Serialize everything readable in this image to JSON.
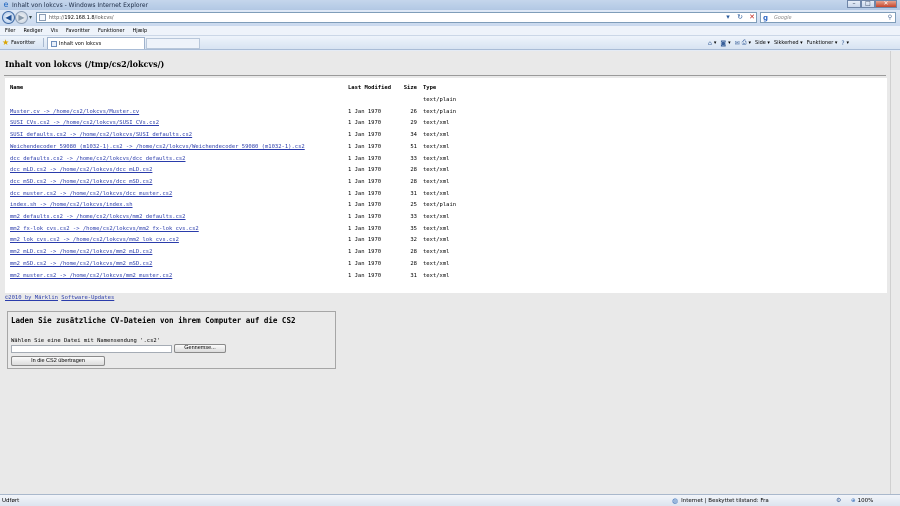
{
  "window": {
    "title": "Inhalt von lokcvs - Windows Internet Explorer",
    "min": "–",
    "max": "□",
    "close": "✕"
  },
  "addressbar": {
    "url_prefix": "http://",
    "url_host": "192.168.1.8",
    "url_path": "/lokcvs/",
    "search_placeholder": "Google"
  },
  "menu": [
    "Filer",
    "Rediger",
    "Vis",
    "Favoritter",
    "Funktioner",
    "Hjælp"
  ],
  "favbar": {
    "favorites_label": "Favoritter",
    "tab_label": "Inhalt von lokcvs",
    "commands": [
      "Side ▾",
      "Sikkerhed ▾",
      "Funktioner ▾"
    ]
  },
  "page": {
    "heading": "Inhalt von lokcvs (/tmp/cs2/lokcvs/)",
    "columns": {
      "name": "Name",
      "date": "Last Modified",
      "size": "Size",
      "type": "Type"
    },
    "rows": [
      {
        "name": "",
        "date": "",
        "size": "",
        "type": "text/plain"
      },
      {
        "name": "Muster.cv -> /home/cs2/lokcvs/Muster.cv",
        "date": "1 Jan 1970",
        "size": "26",
        "type": "text/plain"
      },
      {
        "name": "SUSI_CVs.cs2 -> /home/cs2/lokcvs/SUSI_CVs.cs2",
        "date": "1 Jan 1970",
        "size": "29",
        "type": "text/xml"
      },
      {
        "name": "SUSI_defaults.cs2 -> /home/cs2/lokcvs/SUSI_defaults.cs2",
        "date": "1 Jan 1970",
        "size": "34",
        "type": "text/xml"
      },
      {
        "name": "Weichendecoder_59080_(m1032-1).cs2 -> /home/cs2/lokcvs/Weichendecoder_59080_(m1032-1).cs2",
        "date": "1 Jan 1970",
        "size": "51",
        "type": "text/xml"
      },
      {
        "name": "dcc_defaults.cs2 -> /home/cs2/lokcvs/dcc_defaults.cs2",
        "date": "1 Jan 1970",
        "size": "33",
        "type": "text/xml"
      },
      {
        "name": "dcc_mLD.cs2 -> /home/cs2/lokcvs/dcc_mLD.cs2",
        "date": "1 Jan 1970",
        "size": "28",
        "type": "text/xml"
      },
      {
        "name": "dcc_mSD.cs2 -> /home/cs2/lokcvs/dcc_mSD.cs2",
        "date": "1 Jan 1970",
        "size": "28",
        "type": "text/xml"
      },
      {
        "name": "dcc_muster.cs2 -> /home/cs2/lokcvs/dcc_muster.cs2",
        "date": "1 Jan 1970",
        "size": "31",
        "type": "text/xml"
      },
      {
        "name": "index.sh -> /home/cs2/lokcvs/index.sh",
        "date": "1 Jan 1970",
        "size": "25",
        "type": "text/plain"
      },
      {
        "name": "mm2_defaults.cs2 -> /home/cs2/lokcvs/mm2_defaults.cs2",
        "date": "1 Jan 1970",
        "size": "33",
        "type": "text/xml"
      },
      {
        "name": "mm2_fx-lok_cvs.cs2 -> /home/cs2/lokcvs/mm2_fx-lok_cvs.cs2",
        "date": "1 Jan 1970",
        "size": "35",
        "type": "text/xml"
      },
      {
        "name": "mm2_lok_cvs.cs2 -> /home/cs2/lokcvs/mm2_lok_cvs.cs2",
        "date": "1 Jan 1970",
        "size": "32",
        "type": "text/xml"
      },
      {
        "name": "mm2_mLD.cs2 -> /home/cs2/lokcvs/mm2_mLD.cs2",
        "date": "1 Jan 1970",
        "size": "28",
        "type": "text/xml"
      },
      {
        "name": "mm2_mSD.cs2 -> /home/cs2/lokcvs/mm2_mSD.cs2",
        "date": "1 Jan 1970",
        "size": "28",
        "type": "text/xml"
      },
      {
        "name": "mm2_muster.cs2 -> /home/cs2/lokcvs/mm2_muster.cs2",
        "date": "1 Jan 1970",
        "size": "31",
        "type": "text/xml"
      }
    ],
    "footer_copyright": "©2010 by Märklin",
    "footer_link": "Software-Updates",
    "upload": {
      "heading": "Laden Sie zusätzliche CV-Dateien von ihrem Computer auf die CS2",
      "hint": "Wählen Sie eine Datei mit Namensendung '.cs2'",
      "browse_label": "Gennemse...",
      "submit_label": "In die CS2 übertragen"
    }
  },
  "status": {
    "text": "Udført",
    "security": "Internet | Beskyttet tilstand: Fra",
    "zoom": "100%"
  }
}
